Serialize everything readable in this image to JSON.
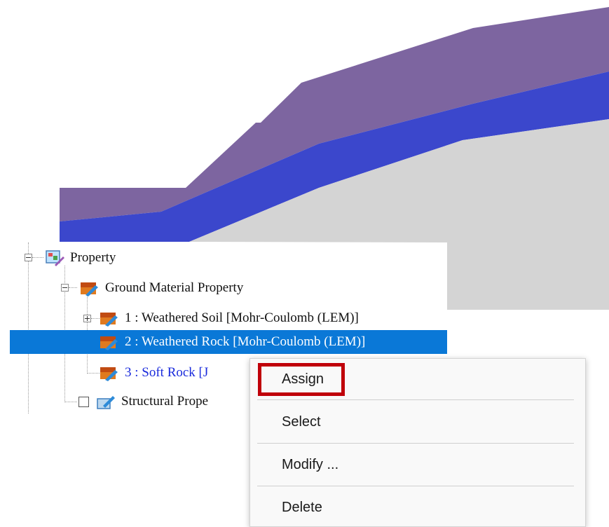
{
  "tree": {
    "root": {
      "label": "Property"
    },
    "ground_material": {
      "label": "Ground Material Property"
    },
    "materials": [
      {
        "label": "1 : Weathered Soil [Mohr-Coulomb (LEM)]"
      },
      {
        "label": "2 : Weathered Rock [Mohr-Coulomb (LEM)]"
      },
      {
        "label": "3 : Soft Rock [J"
      }
    ],
    "structural": {
      "label": "Structural Prope"
    }
  },
  "context_menu": {
    "items": [
      {
        "label": "Assign"
      },
      {
        "label": "Select"
      },
      {
        "label": "Modify ..."
      },
      {
        "label": "Delete"
      }
    ]
  },
  "colors": {
    "layer_top": "#7d65a0",
    "layer_middle": "#3b47cc",
    "layer_bottom": "#d4d4d4",
    "selection": "#0a78d7",
    "highlight_border": "#c0000a",
    "third_item_text": "#1a2bdc"
  },
  "icons": [
    "property-icon",
    "material-icon",
    "structural-icon"
  ]
}
